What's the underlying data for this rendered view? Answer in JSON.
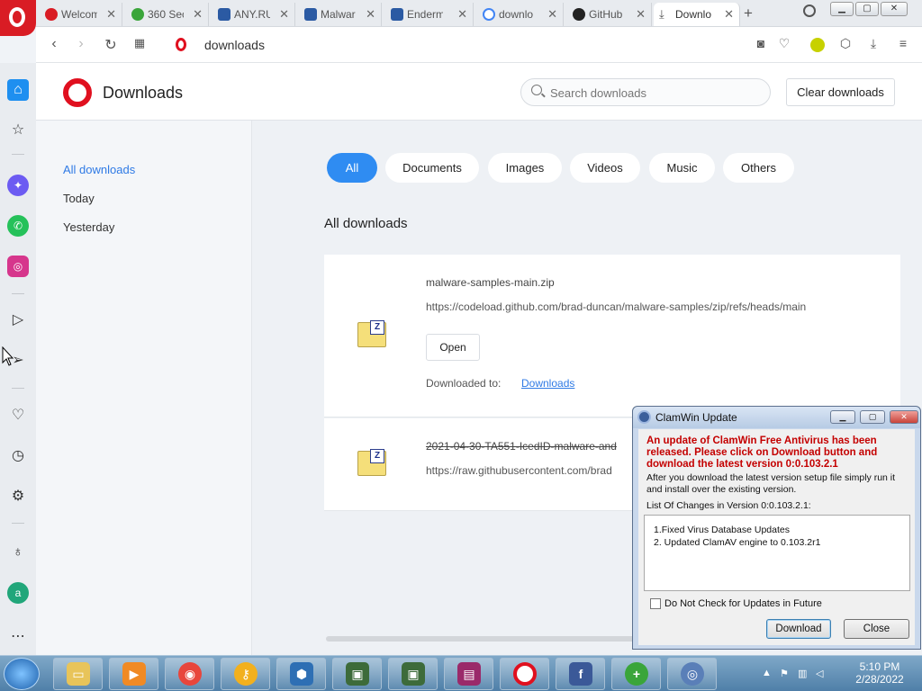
{
  "browser": {
    "tabs": [
      {
        "label": "Welcom",
        "icon": "opera-icon",
        "color": "#d91c24"
      },
      {
        "label": "360 Sec",
        "icon": "360-security-icon",
        "color": "#3aa53a"
      },
      {
        "label": "ANY.RU",
        "icon": "anyrun-icon",
        "color": "#2b5aa3"
      },
      {
        "label": "Malwar",
        "icon": "anyrun-icon",
        "color": "#2b5aa3"
      },
      {
        "label": "Enderm",
        "icon": "anyrun-icon",
        "color": "#2b5aa3"
      },
      {
        "label": "downlo",
        "icon": "google-icon",
        "color": "#4285f4"
      },
      {
        "label": "GitHub",
        "icon": "github-icon",
        "color": "#222222"
      },
      {
        "label": "Downlo",
        "icon": "download-icon",
        "color": "#555555"
      }
    ],
    "url": "downloads"
  },
  "page": {
    "title": "Downloads",
    "search_placeholder": "Search downloads",
    "clear_label": "Clear downloads",
    "left_nav": [
      "All downloads",
      "Today",
      "Yesterday"
    ],
    "filters": [
      "All",
      "Documents",
      "Images",
      "Videos",
      "Music",
      "Others"
    ],
    "section_title": "All downloads",
    "items": [
      {
        "name": "malware-samples-main.zip",
        "url": "https://codeload.github.com/brad-duncan/malware-samples/zip/refs/heads/main",
        "open_label": "Open",
        "downloaded_to_label": "Downloaded to:",
        "folder": "Downloads"
      },
      {
        "name": "2021-04-30-TA551-IcedID-malware-and",
        "url": "https://raw.githubusercontent.com/brad"
      }
    ]
  },
  "dialog": {
    "title": "ClamWin Update",
    "alert": "An update of ClamWin Free Antivirus has been released. Please click on Download button and download the latest version 0:0.103.2.1",
    "info": "After you download the latest version setup file simply run it and install over the existing version.",
    "changes_label": "List Of Changes in Version 0:0.103.2.1:",
    "changes": [
      "1.Fixed Virus Database Updates",
      "2. Updated ClamAV engine to 0.103.2r1"
    ],
    "checkbox_label": "Do Not Check for Updates in Future",
    "download_label": "Download",
    "close_label": "Close"
  },
  "taskbar": {
    "time": "5:10 PM",
    "date": "2/28/2022"
  }
}
